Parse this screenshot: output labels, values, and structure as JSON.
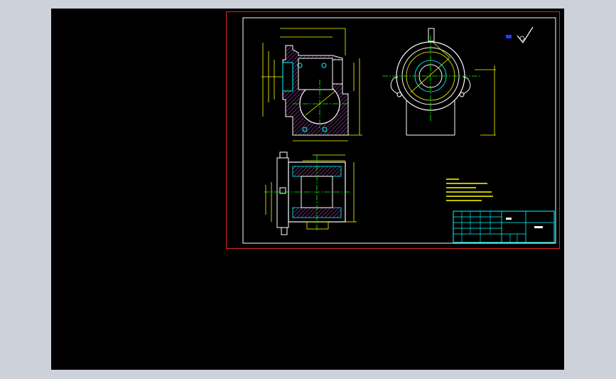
{
  "window": {
    "background_color": "#ccd1da"
  },
  "viewport": {
    "background_color": "#000000"
  },
  "sheet": {
    "border_color": "#e02020",
    "frame_color": "#ffffff",
    "views": [
      "front-section-view",
      "side-view",
      "top-section-view"
    ],
    "colors": {
      "outline": "#ffffff",
      "section_hatch": "#b040c0",
      "dimension": "#ffff00",
      "centerline": "#00ff00",
      "hidden": "#00ffff",
      "title_block": "#00ffff",
      "roughness_symbol": "#ffffff",
      "roughness_tag": "#2040ff"
    }
  }
}
